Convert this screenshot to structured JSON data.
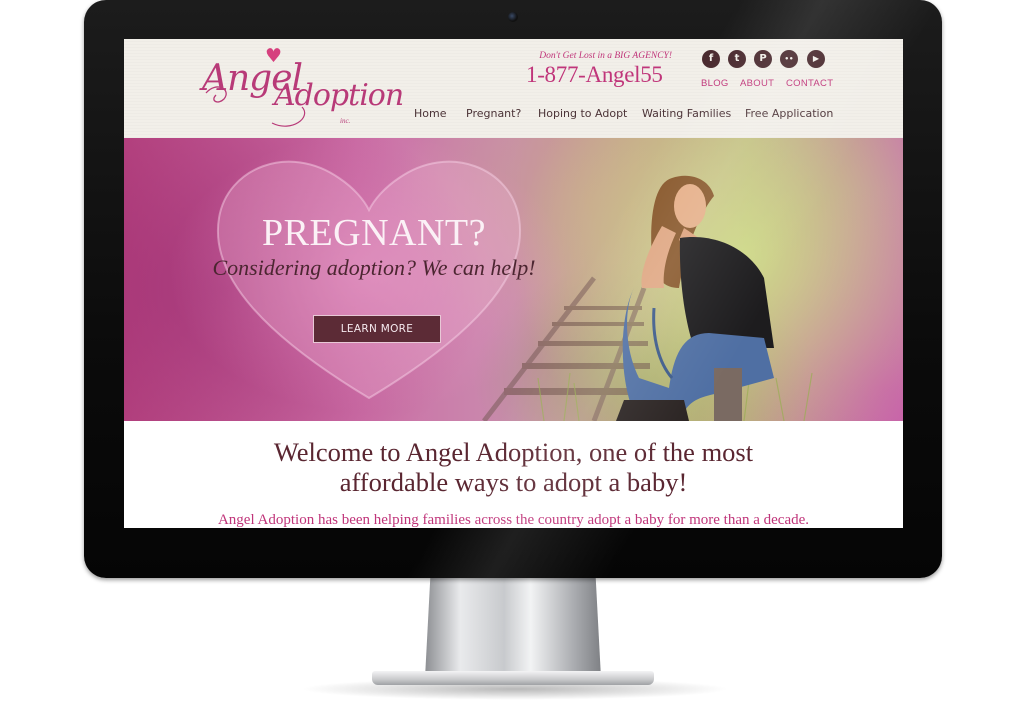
{
  "header": {
    "logo": {
      "line1": "Angel",
      "line2": "Adoption",
      "suffix": "inc."
    },
    "tagline": "Don't Get Lost in a BIG AGENCY!",
    "phone": "1-877-Angel55",
    "social": [
      {
        "name": "facebook-icon",
        "glyph": "f"
      },
      {
        "name": "twitter-icon",
        "glyph": "t"
      },
      {
        "name": "pinterest-icon",
        "glyph": "P"
      },
      {
        "name": "flickr-icon",
        "glyph": "••"
      },
      {
        "name": "youtube-icon",
        "glyph": "▶"
      }
    ],
    "top_links": {
      "blog": "BLOG",
      "about": "ABOUT",
      "contact": "CONTACT"
    }
  },
  "nav": {
    "home": "Home",
    "pregnant": "Pregnant?",
    "hoping": "Hoping to Adopt",
    "waiting": "Waiting Families",
    "application": "Free Application"
  },
  "hero": {
    "title": "PREGNANT?",
    "subtitle": "Considering adoption? We can help!",
    "cta": "LEARN MORE"
  },
  "welcome": {
    "line1": "Welcome to Angel Adoption, one of the most",
    "line2": "affordable ways to adopt a baby!"
  },
  "intro": "Angel Adoption has been helping families across the country adopt a baby for more than a decade.",
  "colors": {
    "brand_pink": "#c0357a",
    "dark_plum": "#5a2631",
    "button_bg": "#5c2b36",
    "header_bg": "#f2efe9"
  }
}
